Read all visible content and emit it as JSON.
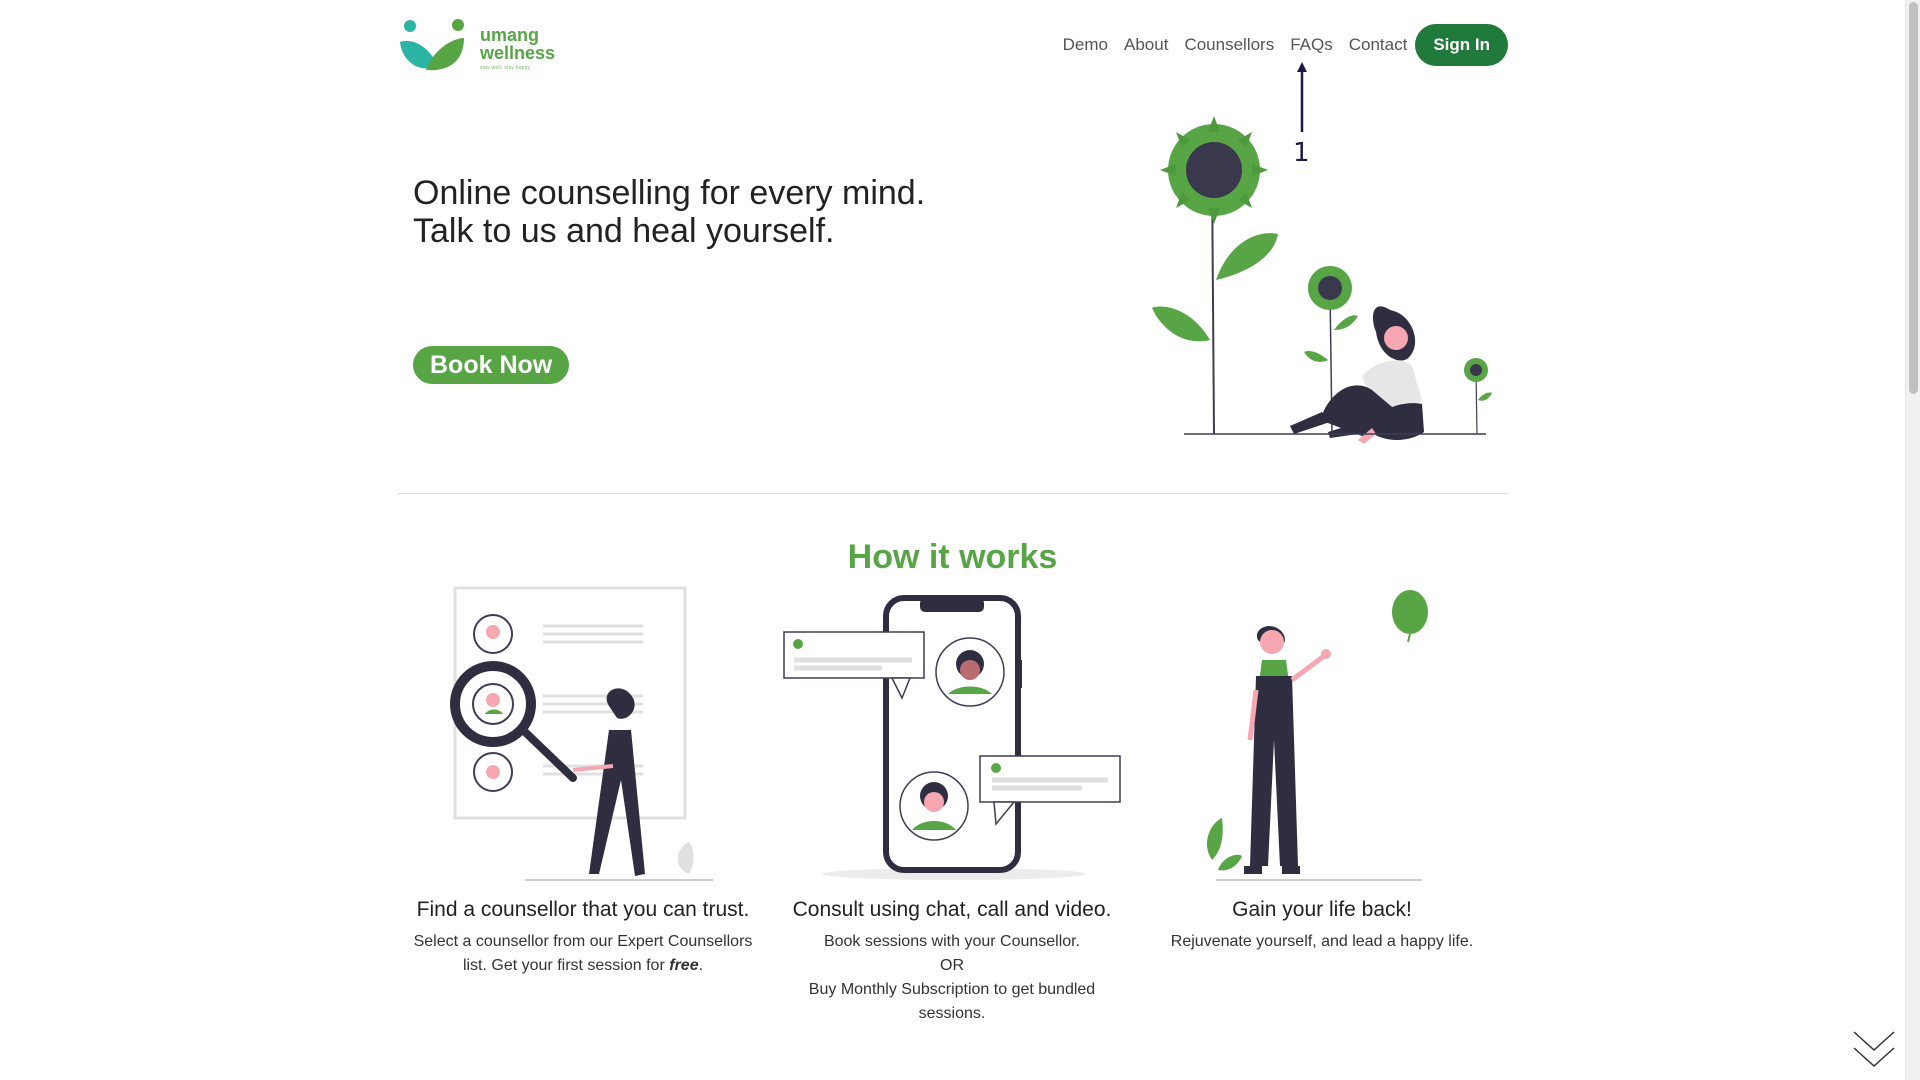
{
  "logo": {
    "line1": "umang",
    "line2": "wellness",
    "tagline": "stay well, stay happy"
  },
  "nav": {
    "items": [
      "Demo",
      "About",
      "Counsellors",
      "FAQs",
      "Contact"
    ],
    "signin_label": "Sign In"
  },
  "hero": {
    "line1": "Online counselling for every mind.",
    "line2": "Talk to us and heal yourself.",
    "cta_label": "Book Now"
  },
  "annotation": {
    "label": "1"
  },
  "how": {
    "title": "How it works",
    "steps": [
      {
        "title": "Find a counsellor that you can trust.",
        "desc_before": "Select a counsellor from our Expert Counsellors list. Get your first session for",
        "desc_emphasis": "free",
        "desc_after": "."
      },
      {
        "title": "Consult using chat, call and video.",
        "desc_line1": "Book sessions with your Counsellor.",
        "desc_line2": "OR",
        "desc_line3": "Buy Monthly Subscription to get bundled sessions."
      },
      {
        "title": "Gain your life back!",
        "desc": "Rejuvenate yourself, and lead a happy life."
      }
    ]
  },
  "colors": {
    "brand_green": "#57a545",
    "dark_green": "#1f7a3b",
    "teal": "#2bb3a4",
    "dark_figure": "#2f2e41",
    "skin": "#f7a7b2"
  }
}
